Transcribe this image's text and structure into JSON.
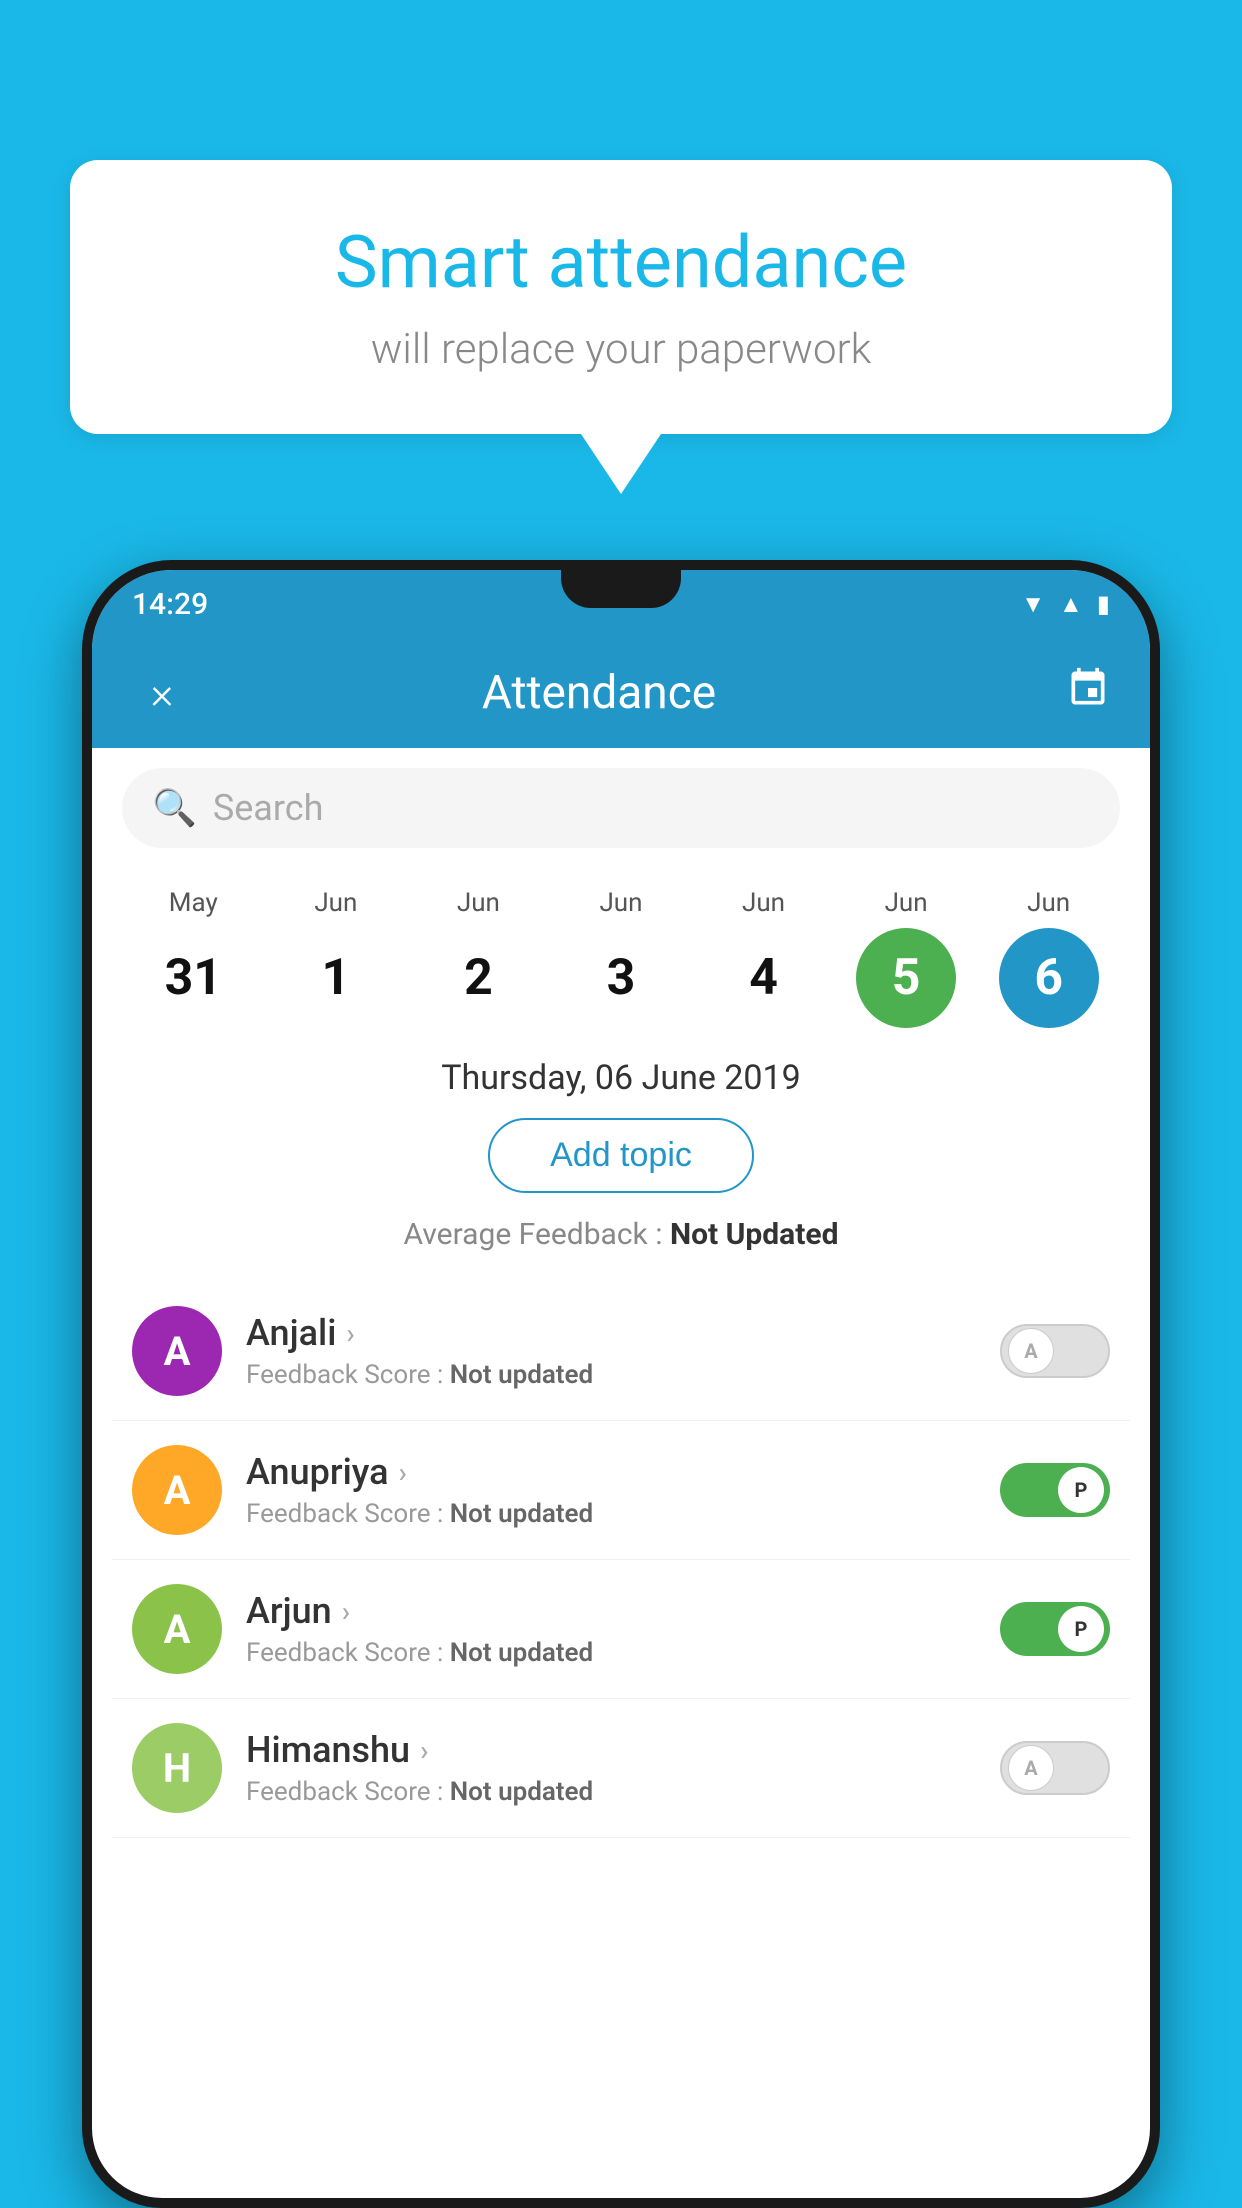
{
  "background_color": "#1ab8e8",
  "speech_bubble": {
    "title": "Smart attendance",
    "subtitle": "will replace your paperwork",
    "tail_visible": true
  },
  "phone": {
    "status_bar": {
      "time": "14:29",
      "icons": [
        "wifi",
        "signal",
        "battery"
      ]
    },
    "app_bar": {
      "title": "Attendance",
      "close_icon": "×",
      "calendar_icon": "📅"
    },
    "search": {
      "placeholder": "Search"
    },
    "calendar": {
      "days": [
        {
          "month": "May",
          "number": "31",
          "state": "normal"
        },
        {
          "month": "Jun",
          "number": "1",
          "state": "normal"
        },
        {
          "month": "Jun",
          "number": "2",
          "state": "normal"
        },
        {
          "month": "Jun",
          "number": "3",
          "state": "normal"
        },
        {
          "month": "Jun",
          "number": "4",
          "state": "normal"
        },
        {
          "month": "Jun",
          "number": "5",
          "state": "today"
        },
        {
          "month": "Jun",
          "number": "6",
          "state": "selected"
        }
      ]
    },
    "selected_date": "Thursday, 06 June 2019",
    "add_topic_label": "Add topic",
    "avg_feedback_label": "Average Feedback :",
    "avg_feedback_value": "Not Updated",
    "students": [
      {
        "name": "Anjali",
        "avatar_letter": "A",
        "avatar_color": "#9c27b0",
        "feedback_label": "Feedback Score :",
        "feedback_value": "Not updated",
        "toggle_state": "off",
        "toggle_label": "A"
      },
      {
        "name": "Anupriya",
        "avatar_letter": "A",
        "avatar_color": "#ffa726",
        "feedback_label": "Feedback Score :",
        "feedback_value": "Not updated",
        "toggle_state": "on",
        "toggle_label": "P"
      },
      {
        "name": "Arjun",
        "avatar_letter": "A",
        "avatar_color": "#8bc34a",
        "feedback_label": "Feedback Score :",
        "feedback_value": "Not updated",
        "toggle_state": "on",
        "toggle_label": "P"
      },
      {
        "name": "Himanshu",
        "avatar_letter": "H",
        "avatar_color": "#9ccc65",
        "feedback_label": "Feedback Score :",
        "feedback_value": "Not updated",
        "toggle_state": "off",
        "toggle_label": "A"
      }
    ]
  }
}
